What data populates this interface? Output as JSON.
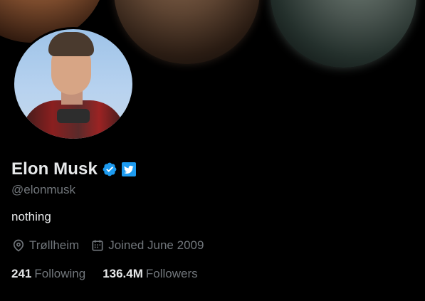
{
  "profile": {
    "name": "Elon Musk",
    "handle": "@elonmusk",
    "bio": "nothing",
    "location": "Trøllheim",
    "joined": "Joined June 2009",
    "following_count": "241",
    "following_label": "Following",
    "followers_count": "136.4M",
    "followers_label": "Followers"
  },
  "icons": {
    "verified": "verified-badge-icon",
    "twitter": "twitter-bird-icon",
    "location": "location-pin-icon",
    "calendar": "calendar-icon"
  },
  "colors": {
    "background": "#000000",
    "text_primary": "#e7e9ea",
    "text_secondary": "#71767b",
    "accent": "#1d9bf0"
  }
}
